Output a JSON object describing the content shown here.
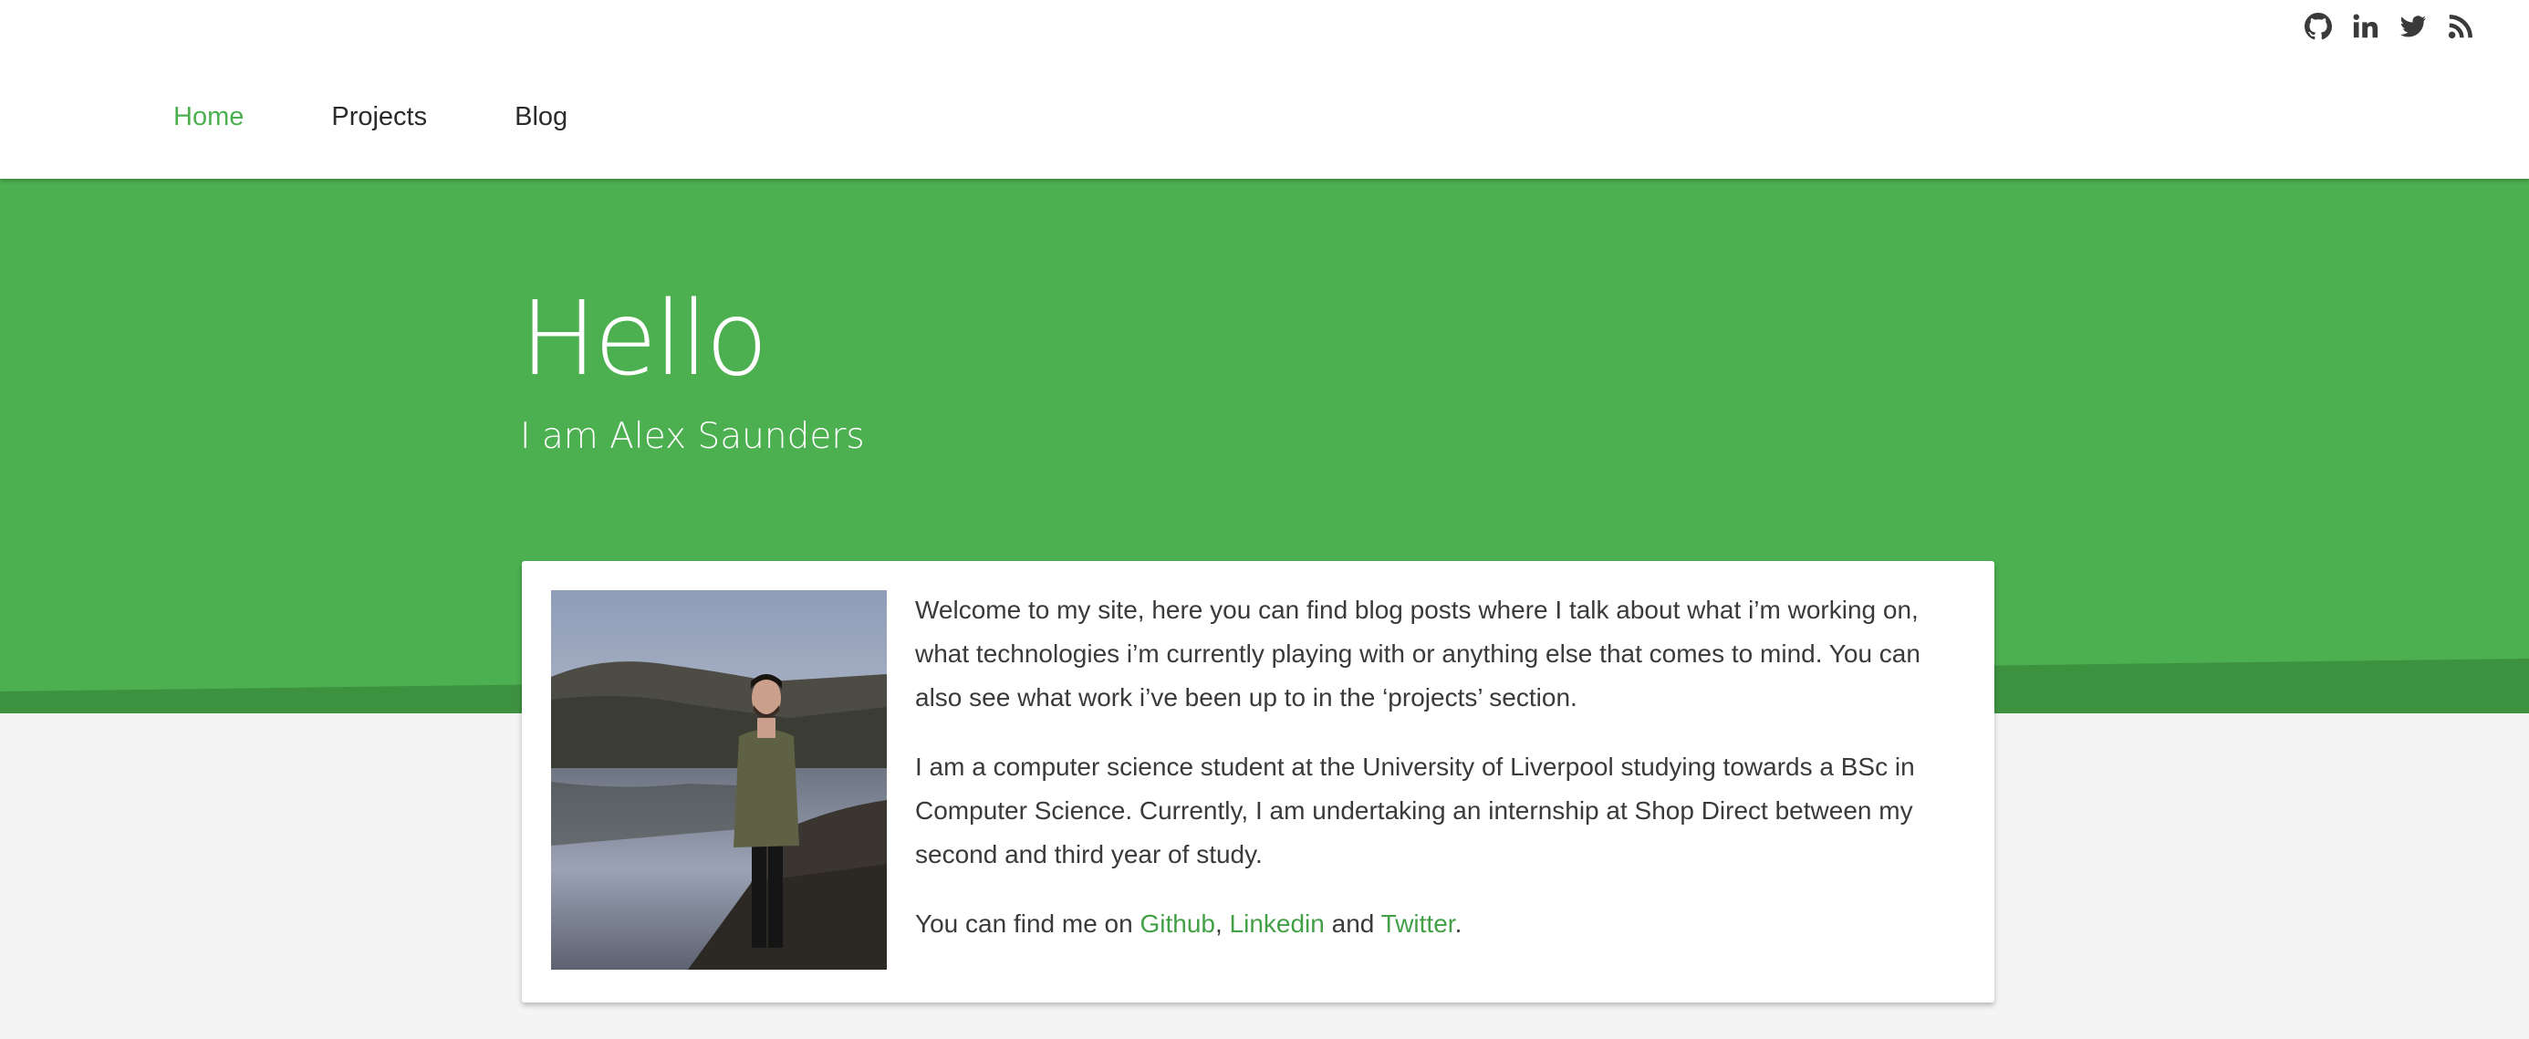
{
  "header": {
    "social_icons": [
      "github-icon",
      "linkedin-icon",
      "twitter-icon",
      "rss-icon"
    ],
    "nav": [
      {
        "label": "Home",
        "active": true
      },
      {
        "label": "Projects",
        "active": false
      },
      {
        "label": "Blog",
        "active": false
      }
    ]
  },
  "hero": {
    "title": "Hello",
    "subtitle": "I am Alex Saunders",
    "color": "#4caf50",
    "wave_color": "#3d9240"
  },
  "card": {
    "photo": "profile-photo",
    "paragraph1": "Welcome to my site, here you can find blog posts where I talk about what i’m working on, what technologies i’m currently playing with or anything else that comes to mind. You can also see what work i’ve been up to in the ‘projects’ section.",
    "paragraph2": "I am a computer science student at the University of Liverpool studying towards a BSc in Computer Science. Currently, I am undertaking an internship at Shop Direct between my second and third year of study.",
    "find_prefix": "You can find me on ",
    "link_github": "Github",
    "sep_comma": ", ",
    "link_linkedin": "Linkedin",
    "sep_and": " and ",
    "link_twitter": "Twitter",
    "find_suffix": ".",
    "link_color": "#43a047"
  }
}
